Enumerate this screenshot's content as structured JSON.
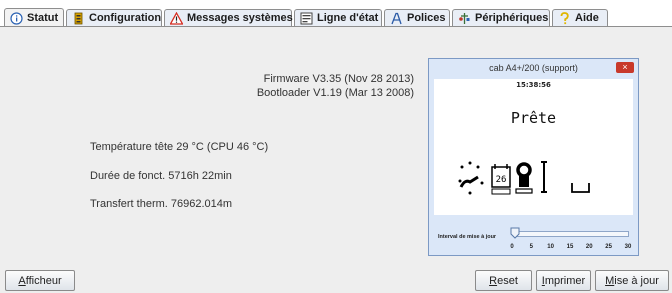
{
  "tabs": [
    {
      "label": "Statut",
      "icon": "info-icon",
      "active": true
    },
    {
      "label": "Configuration",
      "icon": "sliders-icon"
    },
    {
      "label": "Messages systèmes",
      "icon": "warning-icon"
    },
    {
      "label": "Ligne d'état",
      "icon": "statusline-icon"
    },
    {
      "label": "Polices",
      "icon": "font-icon"
    },
    {
      "label": "Périphériques",
      "icon": "devices-icon"
    },
    {
      "label": "Aide",
      "icon": "help-icon"
    }
  ],
  "status": {
    "firmware": "Firmware V3.35 (Nov 28 2013)",
    "bootloader": "Bootloader V1.19 (Mar 13 2008)",
    "temperature": "Température tête 29 °C (CPU 46 °C)",
    "duration": "Durée de fonct. 5716h 22min",
    "transfer": "Transfert therm. 76962.014m"
  },
  "display_window": {
    "title": "cab A4+/200 (support)",
    "close_symbol": "×",
    "time": "15:38:56",
    "state": "Prête",
    "calendar_day": "26",
    "slider_label": "Interval de mise à jour",
    "slider_value": 0,
    "slider_ticks": [
      "0",
      "5",
      "10",
      "15",
      "20",
      "25",
      "30"
    ]
  },
  "buttons": {
    "display_first": "A",
    "display_rest": "fficheur",
    "reset_first": "R",
    "reset_rest": "eset",
    "print_first": "I",
    "print_rest": "mprimer",
    "update_first": "M",
    "update_rest": "ise à jour"
  },
  "colors": {
    "tab_bg": "#e9eef6",
    "window_bg": "#dbe7f8",
    "close_red": "#c8392b",
    "panel_bg": "#eeeeee"
  }
}
